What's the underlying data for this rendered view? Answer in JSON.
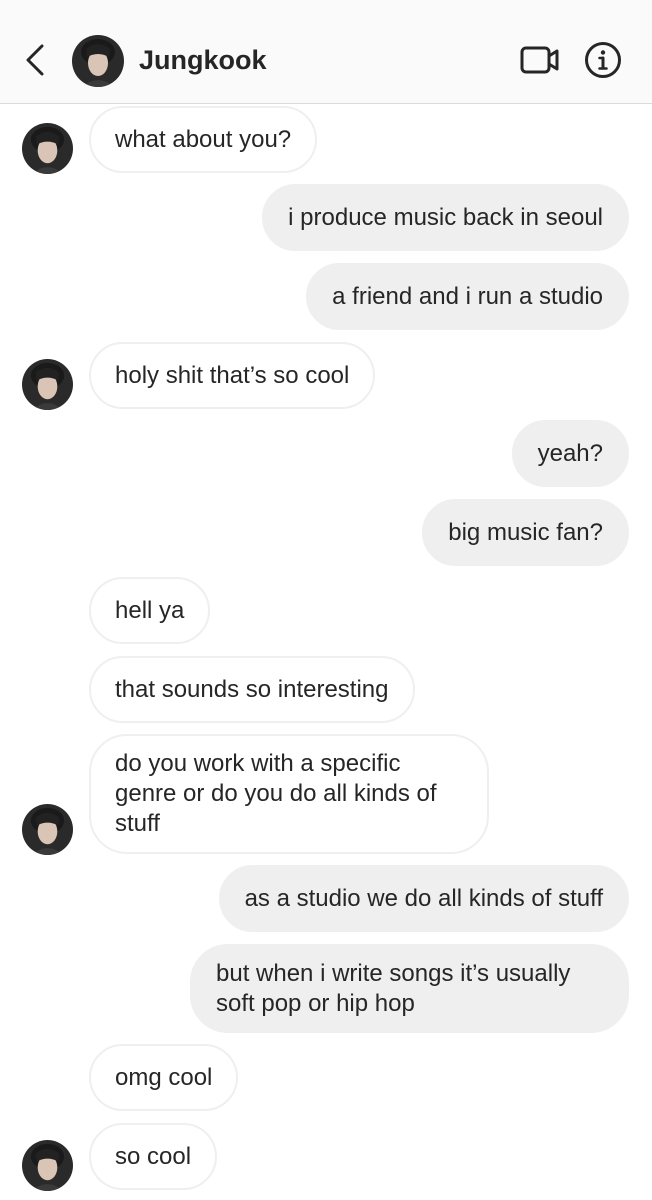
{
  "header": {
    "contact_name": "Jungkook",
    "icons": {
      "back": "chevron-left-icon",
      "video": "video-camera-icon",
      "info": "info-icon"
    }
  },
  "colors": {
    "header_bg": "#fafafa",
    "incoming_bubble_bg": "#ffffff",
    "incoming_bubble_border": "#efefef",
    "outgoing_bubble_bg": "#efefef",
    "text": "#262626"
  },
  "messages": [
    {
      "sender": "them",
      "text": "what about you?"
    },
    {
      "sender": "me",
      "text": "i produce music back in seoul"
    },
    {
      "sender": "me",
      "text": "a friend and i run a studio"
    },
    {
      "sender": "them",
      "text": "holy shit that’s so cool"
    },
    {
      "sender": "me",
      "text": "yeah?"
    },
    {
      "sender": "me",
      "text": "big music fan?"
    },
    {
      "sender": "them",
      "text": "hell ya"
    },
    {
      "sender": "them",
      "text": "that sounds so interesting"
    },
    {
      "sender": "them",
      "text": "do you work with a specific\ngenre or do you do all kinds of\nstuff"
    },
    {
      "sender": "me",
      "text": "as a studio we do all kinds of stuff"
    },
    {
      "sender": "me",
      "text": "but when i write songs it’s usually\nsoft pop or hip hop"
    },
    {
      "sender": "them",
      "text": "omg cool"
    },
    {
      "sender": "them",
      "text": "so cool"
    }
  ]
}
